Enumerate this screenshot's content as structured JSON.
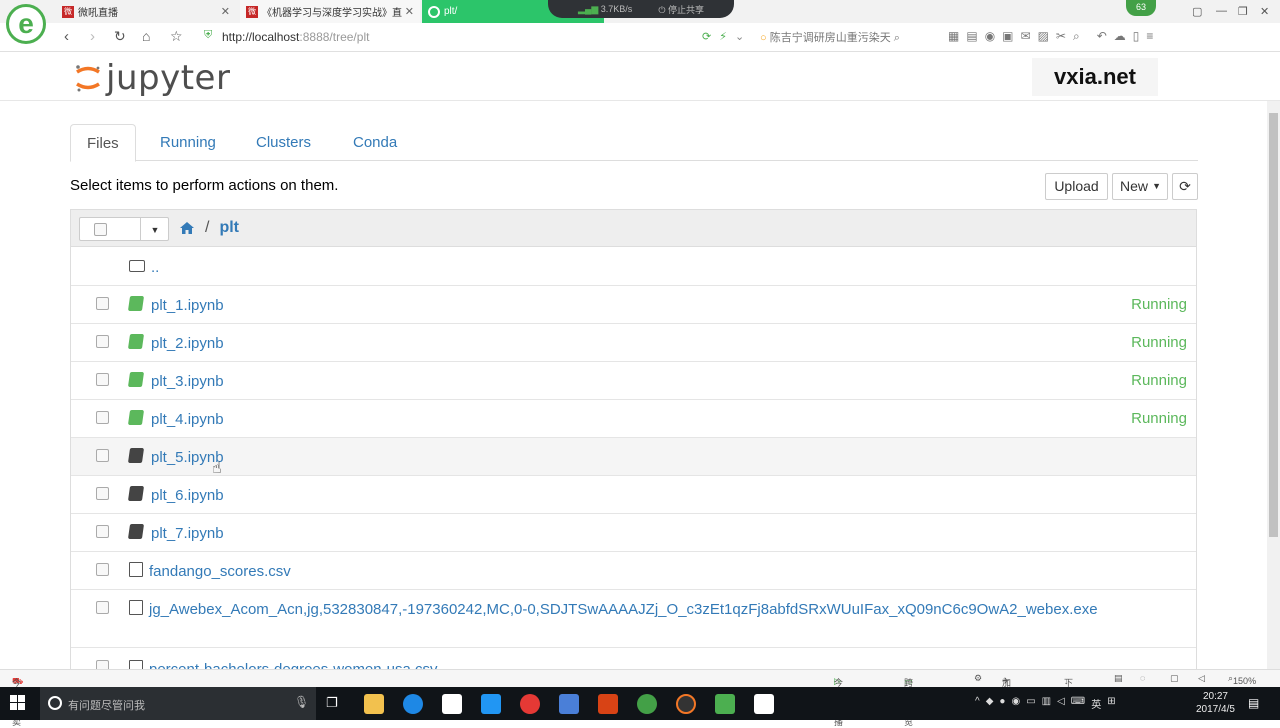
{
  "browser": {
    "tabs": [
      {
        "label": "微吼直播"
      },
      {
        "label": "《机器学习与深度学习实战》直..."
      },
      {
        "label": "plt/"
      }
    ],
    "network_speed": "3.7KB/s",
    "share_label": "停止共享",
    "badge": "63",
    "url_host": "http://localhost",
    "url_rest": ":8888/tree/plt",
    "search_text": "陈吉宁调研房山重污染天",
    "status": {
      "left": "今日特卖",
      "live": "今日直播",
      "browse": "跨屏浏览",
      "accel": "加速器",
      "download": "下载",
      "zoom": "150%"
    }
  },
  "jupyter": {
    "logo_text": "jupyter",
    "watermark": "vxia.net",
    "tabs": [
      "Files",
      "Running",
      "Clusters",
      "Conda"
    ],
    "instruction": "Select items to perform actions on them.",
    "upload_label": "Upload",
    "new_label": "New",
    "breadcrumb": {
      "sep": "/",
      "current": "plt"
    },
    "parent_dir": "..",
    "files": [
      {
        "name": "plt_1.ipynb",
        "status": "Running",
        "kind": "notebook-running"
      },
      {
        "name": "plt_2.ipynb",
        "status": "Running",
        "kind": "notebook-running"
      },
      {
        "name": "plt_3.ipynb",
        "status": "Running",
        "kind": "notebook-running"
      },
      {
        "name": "plt_4.ipynb",
        "status": "Running",
        "kind": "notebook-running"
      },
      {
        "name": "plt_5.ipynb",
        "status": "",
        "kind": "notebook"
      },
      {
        "name": "plt_6.ipynb",
        "status": "",
        "kind": "notebook"
      },
      {
        "name": "plt_7.ipynb",
        "status": "",
        "kind": "notebook"
      },
      {
        "name": "fandango_scores.csv",
        "status": "",
        "kind": "file"
      },
      {
        "name": "jg_Awebex_Acom_Acn,jg,532830847,-197360242,MC,0-0,SDJTSwAAAAJZj_O_c3zEt1qzFj8abfdSRxWUuIFax_xQ09nC6c9OwA2_webex.exe",
        "status": "",
        "kind": "file"
      },
      {
        "name": "percent-bachelors-degrees-women-usa.csv",
        "status": "",
        "kind": "file"
      }
    ]
  },
  "taskbar": {
    "search_placeholder": "有问题尽管问我",
    "ime": "英",
    "time": "20:27",
    "date": "2017/4/5"
  }
}
